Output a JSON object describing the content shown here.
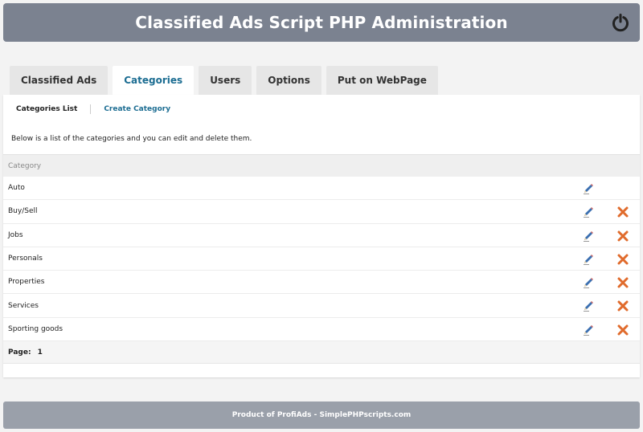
{
  "header": {
    "title": "Classified Ads Script PHP Administration"
  },
  "colors": {
    "header_bg": "#7b8290",
    "active_tab": "#1c6d92",
    "delete": "#e06b2c",
    "edit": "#3b6fb0"
  },
  "icons": {
    "power": "power-icon",
    "edit": "pencil-icon",
    "delete": "close-icon"
  },
  "tabs": [
    {
      "label": "Classified Ads"
    },
    {
      "label": "Categories"
    },
    {
      "label": "Users"
    },
    {
      "label": "Options"
    },
    {
      "label": "Put on WebPage"
    }
  ],
  "subnav": {
    "list": "Categories List",
    "create": "Create Category"
  },
  "intro": "Below is a list of the categories and you can edit and delete them.",
  "table": {
    "header": "Category",
    "rows": [
      {
        "name": "Auto",
        "delete": false
      },
      {
        "name": "Buy/Sell",
        "delete": true
      },
      {
        "name": "Jobs",
        "delete": true
      },
      {
        "name": "Personals",
        "delete": true
      },
      {
        "name": "Properties",
        "delete": true
      },
      {
        "name": "Services",
        "delete": true
      },
      {
        "name": "Sporting goods",
        "delete": true
      }
    ]
  },
  "pager": {
    "label": "Page:",
    "current": "1"
  },
  "footer": {
    "text": "Product of ProfiAds - SimplePHPscripts.com"
  }
}
